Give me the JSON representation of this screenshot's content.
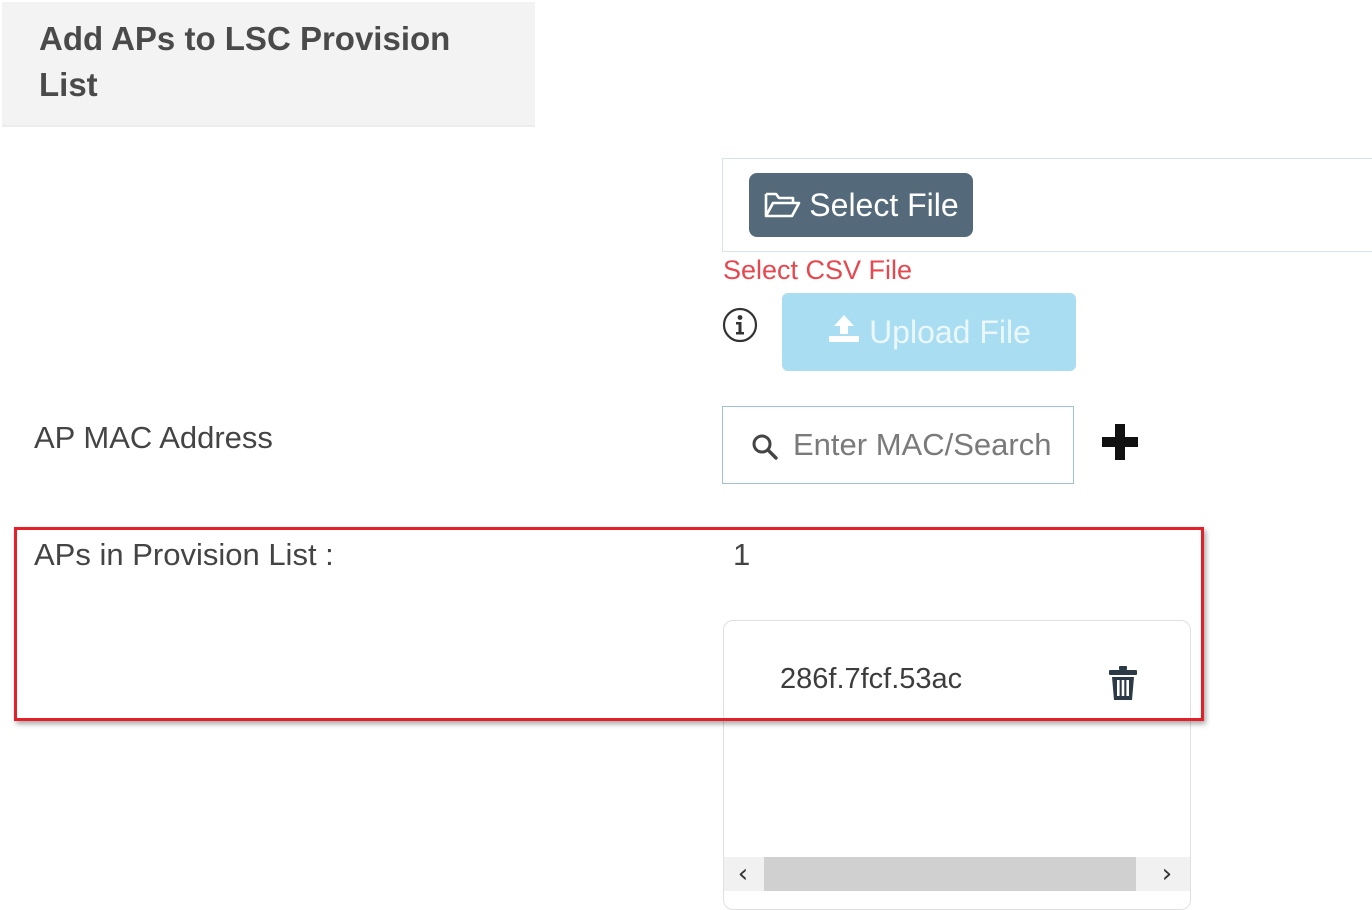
{
  "section": {
    "title": "Add APs to LSC Provision List"
  },
  "file_upload": {
    "select_label": "Select File",
    "hint": "Select CSV File",
    "upload_label": "Upload File"
  },
  "mac": {
    "label": "AP MAC Address",
    "placeholder": "Enter MAC/Search"
  },
  "provision": {
    "label": "APs in Provision List :",
    "count": "1",
    "items": [
      {
        "mac": "286f.7fcf.53ac"
      }
    ]
  },
  "scrollbar": {
    "left_arrow": "‹",
    "right_arrow": "›"
  },
  "colors": {
    "select_button": "#546a7b",
    "upload_button_disabled": "#a9ddf2",
    "hint_text": "#e8474f",
    "highlight_box": "#e32028"
  },
  "icons": {
    "select_file": "folder-open-icon",
    "upload": "upload-icon",
    "info": "info-icon",
    "search": "search-icon",
    "add": "plus-icon",
    "delete": "trash-icon"
  }
}
